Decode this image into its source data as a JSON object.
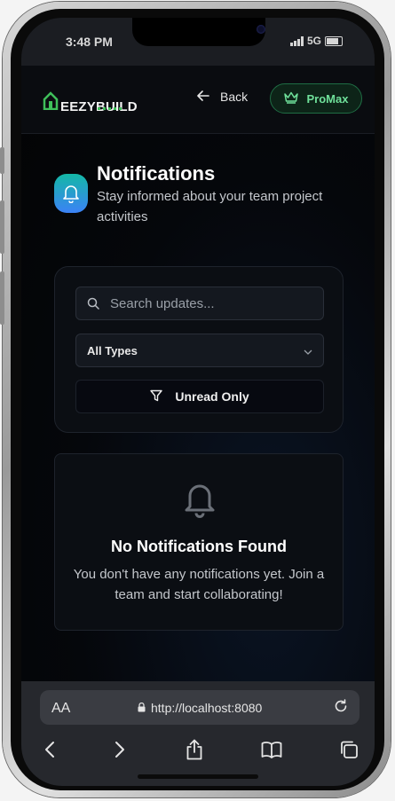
{
  "status_bar": {
    "time": "3:48 PM",
    "network": "5G"
  },
  "header": {
    "logo_text": "EEZYBUILD",
    "back_label": "Back",
    "promax_label": "ProMax"
  },
  "page": {
    "title": "Notifications",
    "subtitle": "Stay informed about your team project activities"
  },
  "filters": {
    "search_placeholder": "Search updates...",
    "type_selected": "All Types",
    "unread_label": "Unread Only"
  },
  "empty_state": {
    "title": "No Notifications Found",
    "message": "You don't have any notifications yet. Join a team and start collaborating!"
  },
  "browser": {
    "aa_label": "AA",
    "url": "http://localhost:8080"
  },
  "icons": {
    "logo": "house-logo-icon",
    "back": "arrow-left-icon",
    "promax": "crown-icon",
    "title": "bell-icon",
    "search": "search-icon",
    "select": "chevron-down-icon",
    "unread": "filter-icon",
    "empty": "bell-icon",
    "lock": "lock-icon",
    "reload": "reload-icon",
    "nav": [
      "back-arrow-icon",
      "forward-arrow-icon",
      "share-icon",
      "bookmarks-icon",
      "tabs-icon"
    ]
  },
  "colors": {
    "accent_green": "#6fe09a",
    "brand_green": "#3fbf5a",
    "title_icon_gradient": [
      "#14b8a6",
      "#3b82f6"
    ],
    "background": "#05070b"
  }
}
